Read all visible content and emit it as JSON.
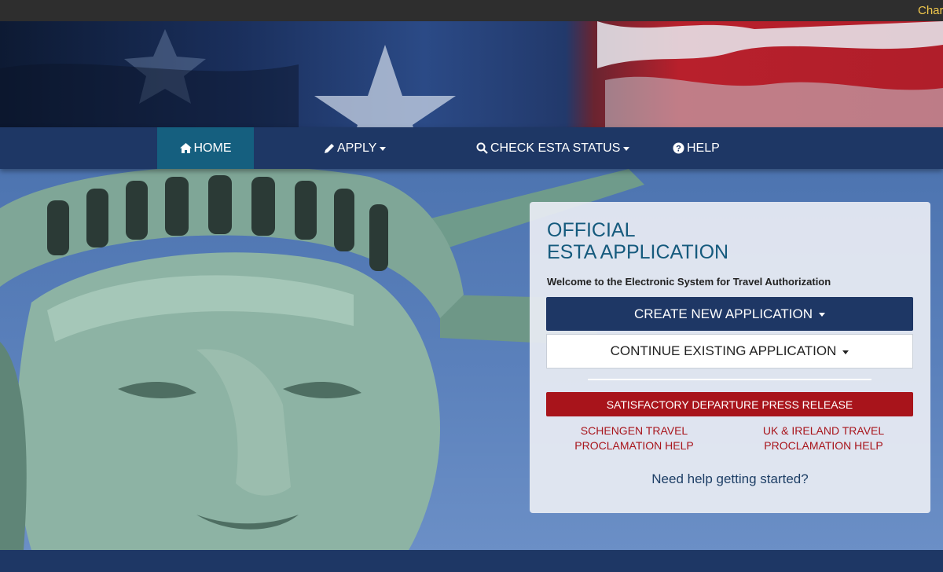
{
  "browser": {
    "top_right_text": "Char"
  },
  "nav": {
    "home": "HOME",
    "apply": "APPLY",
    "check_status": "CHECK ESTA STATUS",
    "help": "HELP"
  },
  "panel": {
    "title_line1": "OFFICIAL",
    "title_line2": "ESTA APPLICATION",
    "welcome": "Welcome to the Electronic System for Travel Authorization",
    "create_new": "CREATE NEW APPLICATION",
    "continue_existing": "CONTINUE EXISTING APPLICATION",
    "press_release": "SATISFACTORY DEPARTURE PRESS RELEASE",
    "schengen_line1": "SCHENGEN TRAVEL",
    "schengen_line2": "PROCLAMATION HELP",
    "uk_line1": "UK & IRELAND TRAVEL",
    "uk_line2": "PROCLAMATION HELP",
    "need_help": "Need help getting started?"
  },
  "colors": {
    "navy": "#1e3765",
    "active_tab": "#155f7f",
    "title_blue": "#155a7d",
    "alert_red": "#a8141b"
  },
  "icons": {
    "home": "home-icon",
    "apply": "pencil-icon",
    "check_status": "search-icon",
    "help": "question-circle-icon"
  }
}
